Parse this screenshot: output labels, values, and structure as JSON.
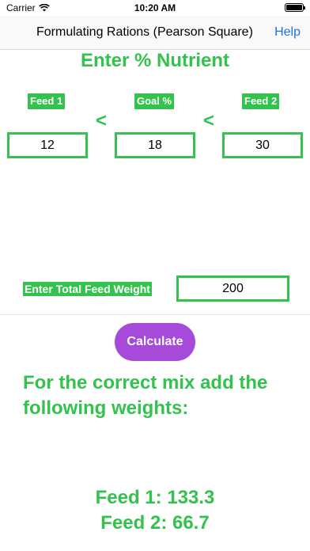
{
  "status_bar": {
    "carrier": "Carrier",
    "time": "10:20 AM",
    "battery_level": 1.0
  },
  "nav": {
    "title": "Formulating Rations (Pearson Square)",
    "help": "Help"
  },
  "heading": "Enter % Nutrient",
  "feed1": {
    "label": "Feed 1",
    "value": "12"
  },
  "goal": {
    "label": "Goal %",
    "value": "18"
  },
  "feed2": {
    "label": "Feed 2",
    "value": "30"
  },
  "arrows": {
    "left": "<",
    "right": "<"
  },
  "total_weight": {
    "label": "Enter Total Feed Weight",
    "value": "200"
  },
  "calculate": "Calculate",
  "result": {
    "title": "For the correct mix add the following weights:",
    "feed1": "Feed 1: 133.3",
    "feed2": "Feed 2: 66.7"
  },
  "colors": {
    "accent_green": "#33c24d",
    "button_purple": "#a64ad9",
    "link_blue": "#1a73e8"
  }
}
